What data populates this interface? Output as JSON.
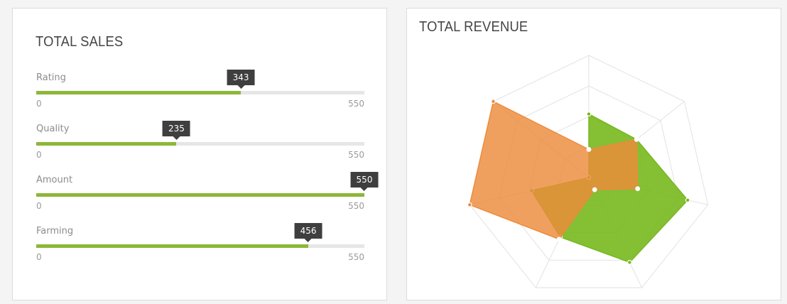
{
  "sales": {
    "title": "TOTAL SALES",
    "bars": [
      {
        "label": "Rating",
        "value": 343,
        "value_text": "343",
        "min_text": "0",
        "max_text": "550",
        "max": 550
      },
      {
        "label": "Quality",
        "value": 235,
        "value_text": "235",
        "min_text": "0",
        "max_text": "550",
        "max": 550
      },
      {
        "label": "Amount",
        "value": 550,
        "value_text": "550",
        "min_text": "0",
        "max_text": "550",
        "max": 550
      },
      {
        "label": "Farming",
        "value": 456,
        "value_text": "456",
        "min_text": "0",
        "max_text": "550",
        "max": 550
      }
    ],
    "colors": {
      "fill": "#8cb738",
      "track": "#e6e6e6",
      "tooltip": "#3f3f3f"
    }
  },
  "revenue": {
    "title": "TOTAL REVENUE",
    "chart_data": {
      "type": "radar",
      "axes_count": 7,
      "rmax": 100,
      "grid_levels": 4,
      "grid": true,
      "series": [
        {
          "values": [
            52,
            50,
            83,
            77,
            54,
            48,
            0
          ],
          "color": "#77b81e"
        },
        {
          "values": [
            23,
            50,
            41,
            11,
            56,
            100,
            100
          ],
          "color": "#ed8b3a"
        }
      ]
    }
  }
}
